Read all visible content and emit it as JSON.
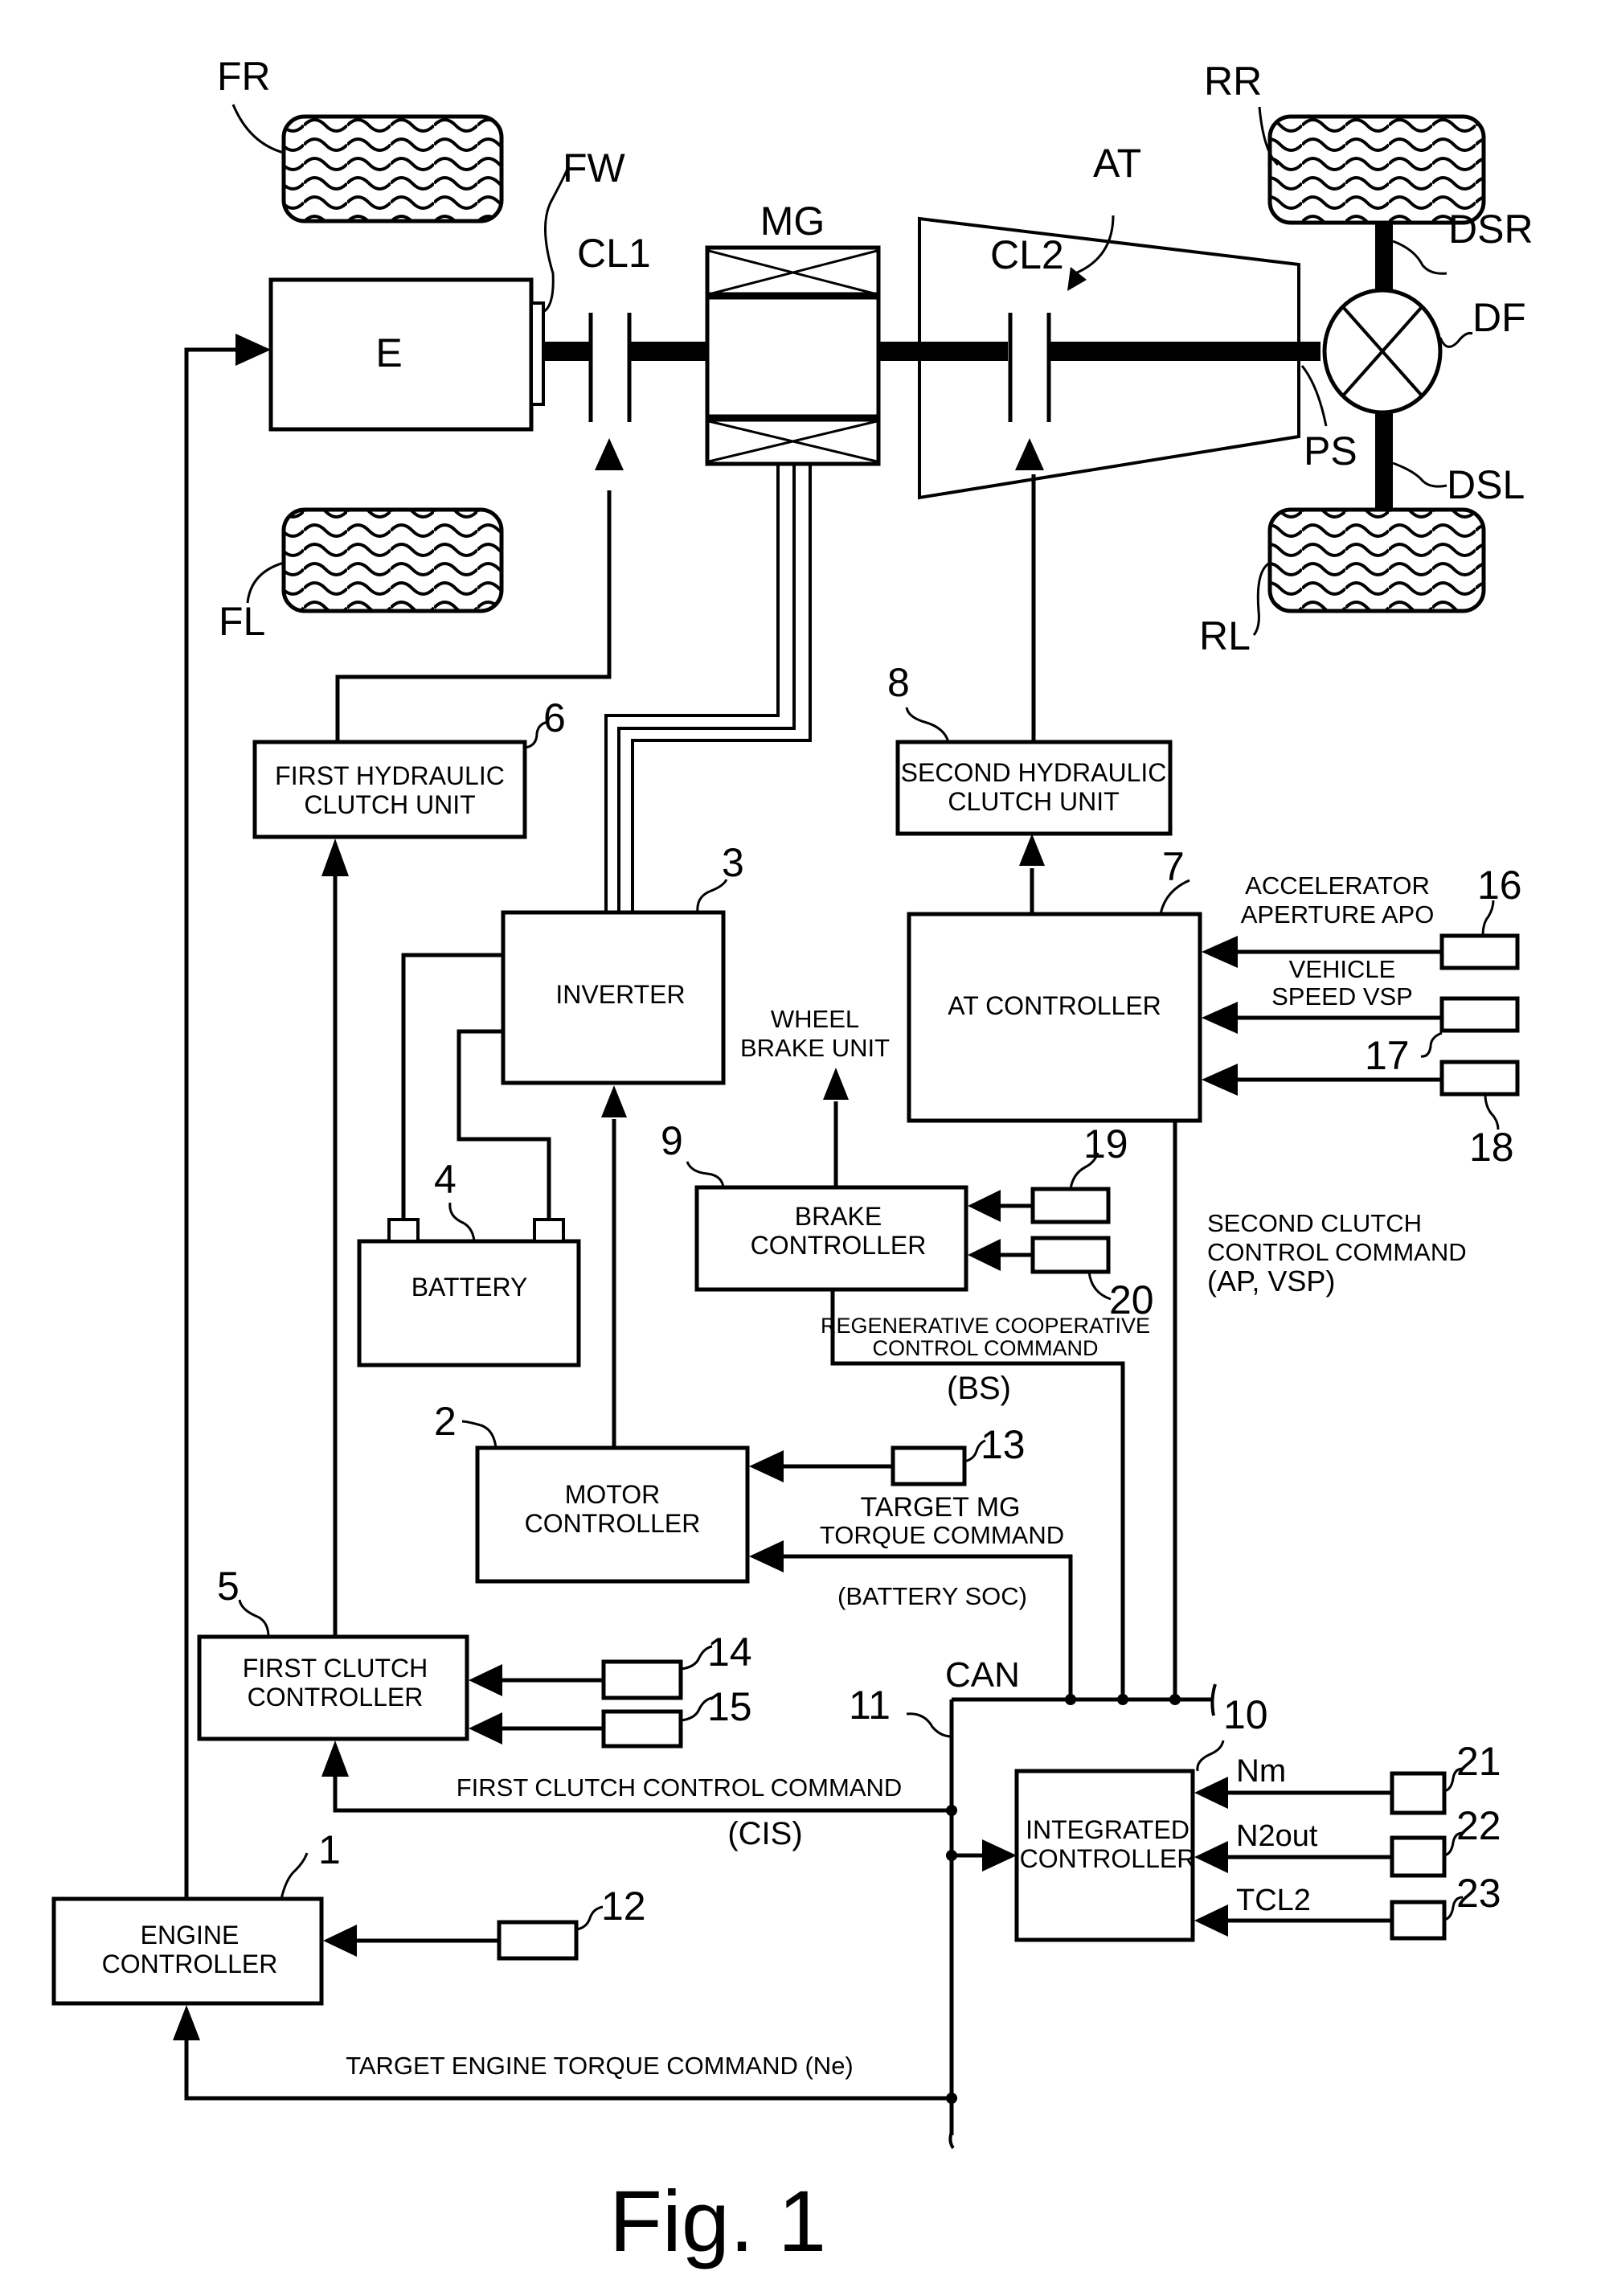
{
  "figure": {
    "caption": "Fig. 1",
    "colors": {
      "ink": "#000000",
      "background": "#ffffff"
    }
  },
  "drivetrain": {
    "front_right_tire": "FR",
    "front_left_tire": "FL",
    "rear_right_tire": "RR",
    "rear_left_tire": "RL",
    "engine": "E",
    "flywheel": "FW",
    "first_clutch": "CL1",
    "motor_generator": "MG",
    "automatic_transmission": "AT",
    "second_clutch": "CL2",
    "differential": "DF",
    "propeller_shaft": "PS",
    "drive_shaft_right": "DSR",
    "drive_shaft_left": "DSL"
  },
  "blocks": {
    "first_hydraulic": {
      "line1": "FIRST HYDRAULIC",
      "line2": "CLUTCH UNIT",
      "ref": "6"
    },
    "second_hydraulic": {
      "line1": "SECOND HYDRAULIC",
      "line2": "CLUTCH UNIT",
      "ref": "8"
    },
    "inverter": {
      "line1": "INVERTER",
      "ref": "3"
    },
    "battery": {
      "line1": "BATTERY",
      "ref": "4"
    },
    "at_controller": {
      "line1": "AT CONTROLLER",
      "ref": "7"
    },
    "brake_controller": {
      "line1": "BRAKE",
      "line2": "CONTROLLER",
      "ref": "9"
    },
    "motor_controller": {
      "line1": "MOTOR",
      "line2": "CONTROLLER",
      "ref": "2"
    },
    "first_clutch_controller": {
      "line1": "FIRST CLUTCH",
      "line2": "CONTROLLER",
      "ref": "5"
    },
    "engine_controller": {
      "line1": "ENGINE",
      "line2": "CONTROLLER",
      "ref": "1"
    },
    "integrated_controller": {
      "line1": "INTEGRATED",
      "line2": "CONTROLLER",
      "ref": "10"
    }
  },
  "sensors": {
    "s12": "12",
    "s13": "13",
    "s14": "14",
    "s15": "15",
    "s16": "16",
    "s17": "17",
    "s18": "18",
    "s19": "19",
    "s20": "20",
    "s21": "21",
    "s22": "22",
    "s23": "23"
  },
  "annotations": {
    "wheel_brake_1": "WHEEL",
    "wheel_brake_2": "BRAKE UNIT",
    "accel_1": "ACCELERATOR",
    "accel_2": "APERTURE APO",
    "vsp_1": "VEHICLE",
    "vsp_2": "SPEED VSP",
    "second_clutch_cmd_1": "SECOND CLUTCH",
    "second_clutch_cmd_2": "CONTROL COMMAND",
    "second_clutch_cmd_3": "(AP, VSP)",
    "regen_1": "REGENERATIVE COOPERATIVE",
    "regen_2": "CONTROL COMMAND",
    "regen_3": "(BS)",
    "target_mg_1": "TARGET MG",
    "target_mg_2": "TORQUE COMMAND",
    "battery_soc": "(BATTERY SOC)",
    "can": "CAN",
    "can_ref": "11",
    "first_clutch_cmd": "FIRST CLUTCH CONTROL COMMAND",
    "cis": "(CIS)",
    "target_engine_cmd": "TARGET ENGINE TORQUE COMMAND (Ne)",
    "nm": "Nm",
    "n2out": "N2out",
    "tcl2": "TCL2"
  }
}
